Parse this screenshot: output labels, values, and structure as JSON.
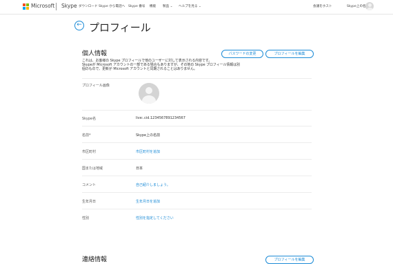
{
  "header": {
    "brand": "Microsoft",
    "product": "Skype",
    "nav": [
      {
        "label": "ダウンロード"
      },
      {
        "label": "Skype から電話へ"
      },
      {
        "label": "Skype 番号"
      },
      {
        "label": "機能"
      },
      {
        "label": "製品 ⌄"
      },
      {
        "label": "ヘルプを見る ⌄"
      }
    ],
    "signout": "会議をホスト",
    "username": "Skype上の名前"
  },
  "page": {
    "title": "プロフィール"
  },
  "personal": {
    "title": "個人情報",
    "change_password": "パスワードの変更",
    "edit_profile": "プロフィールを編集",
    "description": [
      "これは、お客様の Skype プロフィールで他のユーザーに対して表示される内容です。",
      "Skypeが Microsoft アカウントの一部である場合もありますが、その他の Skype プロフィール情報は別",
      "個のもので、更新が Microsoft アカウントと同期されることはありません。"
    ],
    "rows": {
      "picture": {
        "label": "プロフィール画像"
      },
      "skype_name": {
        "label": "Skype名",
        "value": "live:.cid.1234567891234567"
      },
      "name": {
        "label": "名前*",
        "value": "Skype上の名前"
      },
      "city": {
        "label": "市区町村",
        "value": "市区町村を追加"
      },
      "country": {
        "label": "国または地域",
        "value": "日本"
      },
      "comment": {
        "label": "コメント",
        "value": "自己紹介しましょう。"
      },
      "birthday": {
        "label": "生年月日",
        "value": "生年月日を追加"
      },
      "gender": {
        "label": "性別",
        "value": "性別を指定してください"
      }
    }
  },
  "contact": {
    "title": "連絡情報",
    "edit_profile": "プロフィールを編集"
  },
  "colors": {
    "accent": "#1a8ad6"
  }
}
